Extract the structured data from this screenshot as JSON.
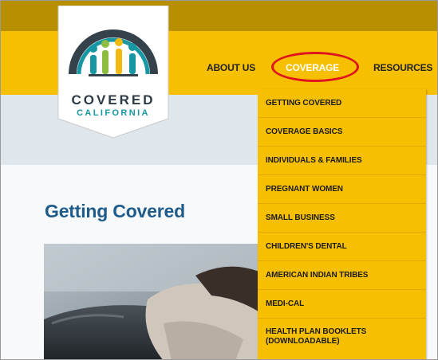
{
  "logo": {
    "word1": "COVERED",
    "word2": "CALIFORNIA"
  },
  "nav": {
    "about": "ABOUT US",
    "coverage": "COVERAGE",
    "resources": "RESOURCES"
  },
  "dropdown": {
    "items": [
      "GETTING COVERED",
      "COVERAGE BASICS",
      "INDIVIDUALS & FAMILIES",
      "PREGNANT WOMEN",
      "SMALL BUSINESS",
      "CHILDREN'S DENTAL",
      "AMERICAN INDIAN TRIBES",
      "MEDI-CAL",
      "HEALTH PLAN BOOKLETS (DOWNLOADABLE)"
    ]
  },
  "main": {
    "title": "Getting Covered"
  },
  "colors": {
    "nav_yellow": "#f6bf00",
    "top_strip": "#b88f00",
    "heading_blue": "#1f5b8a",
    "highlight_red": "#e0141e",
    "logo_teal": "#1796a3"
  }
}
